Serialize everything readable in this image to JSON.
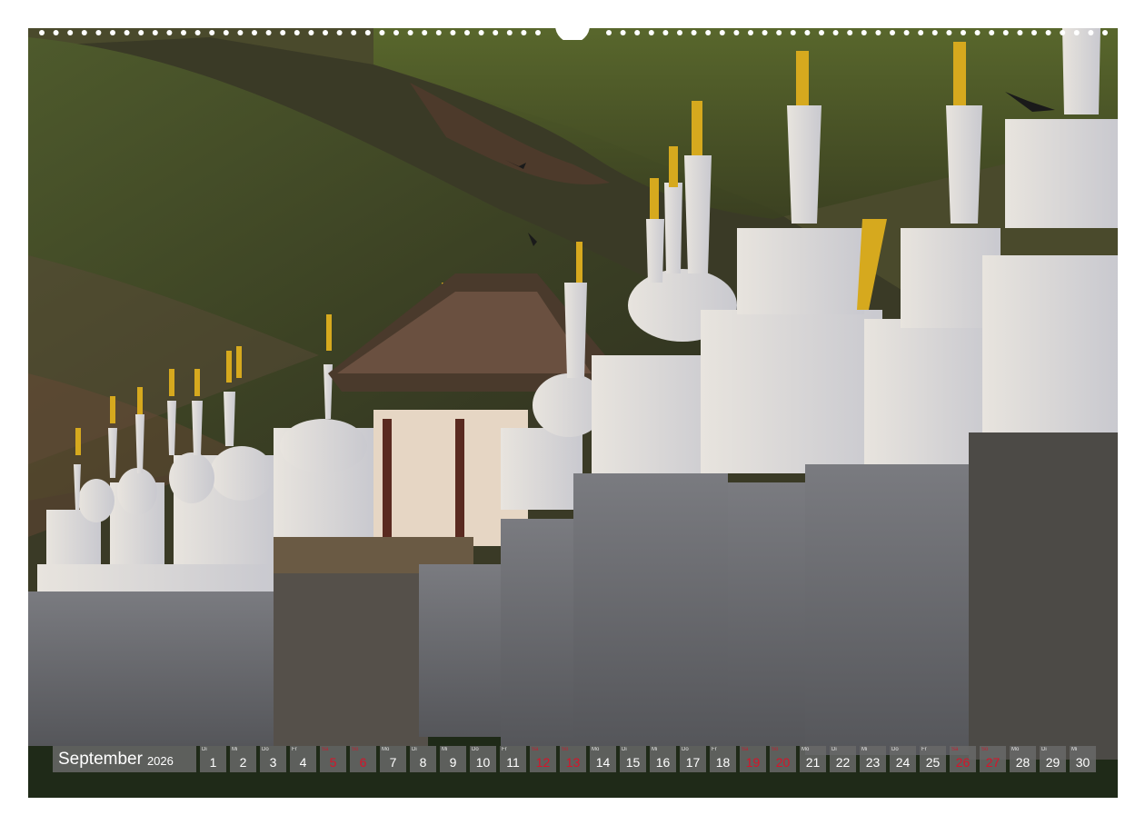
{
  "calendar": {
    "month": "September",
    "year": "2026",
    "days": [
      {
        "dow": "Di",
        "num": "1",
        "red": false
      },
      {
        "dow": "Mi",
        "num": "2",
        "red": false
      },
      {
        "dow": "Do",
        "num": "3",
        "red": false
      },
      {
        "dow": "Fr",
        "num": "4",
        "red": false
      },
      {
        "dow": "Sa",
        "num": "5",
        "red": true
      },
      {
        "dow": "So",
        "num": "6",
        "red": true
      },
      {
        "dow": "Mo",
        "num": "7",
        "red": false
      },
      {
        "dow": "Di",
        "num": "8",
        "red": false
      },
      {
        "dow": "Mi",
        "num": "9",
        "red": false
      },
      {
        "dow": "Do",
        "num": "10",
        "red": false
      },
      {
        "dow": "Fr",
        "num": "11",
        "red": false
      },
      {
        "dow": "Sa",
        "num": "12",
        "red": true
      },
      {
        "dow": "So",
        "num": "13",
        "red": true
      },
      {
        "dow": "Mo",
        "num": "14",
        "red": false
      },
      {
        "dow": "Di",
        "num": "15",
        "red": false
      },
      {
        "dow": "Mi",
        "num": "16",
        "red": false
      },
      {
        "dow": "Do",
        "num": "17",
        "red": false
      },
      {
        "dow": "Fr",
        "num": "18",
        "red": false
      },
      {
        "dow": "Sa",
        "num": "19",
        "red": true
      },
      {
        "dow": "So",
        "num": "20",
        "red": true
      },
      {
        "dow": "Mo",
        "num": "21",
        "red": false
      },
      {
        "dow": "Di",
        "num": "22",
        "red": false
      },
      {
        "dow": "Mi",
        "num": "23",
        "red": false
      },
      {
        "dow": "Do",
        "num": "24",
        "red": false
      },
      {
        "dow": "Fr",
        "num": "25",
        "red": false
      },
      {
        "dow": "Sa",
        "num": "26",
        "red": true
      },
      {
        "dow": "So",
        "num": "27",
        "red": true
      },
      {
        "dow": "Mo",
        "num": "28",
        "red": false
      },
      {
        "dow": "Di",
        "num": "29",
        "red": false
      },
      {
        "dow": "Mi",
        "num": "30",
        "red": false
      }
    ]
  },
  "colors": {
    "weekend": "#d6142a",
    "strip_bg": "#696969"
  }
}
